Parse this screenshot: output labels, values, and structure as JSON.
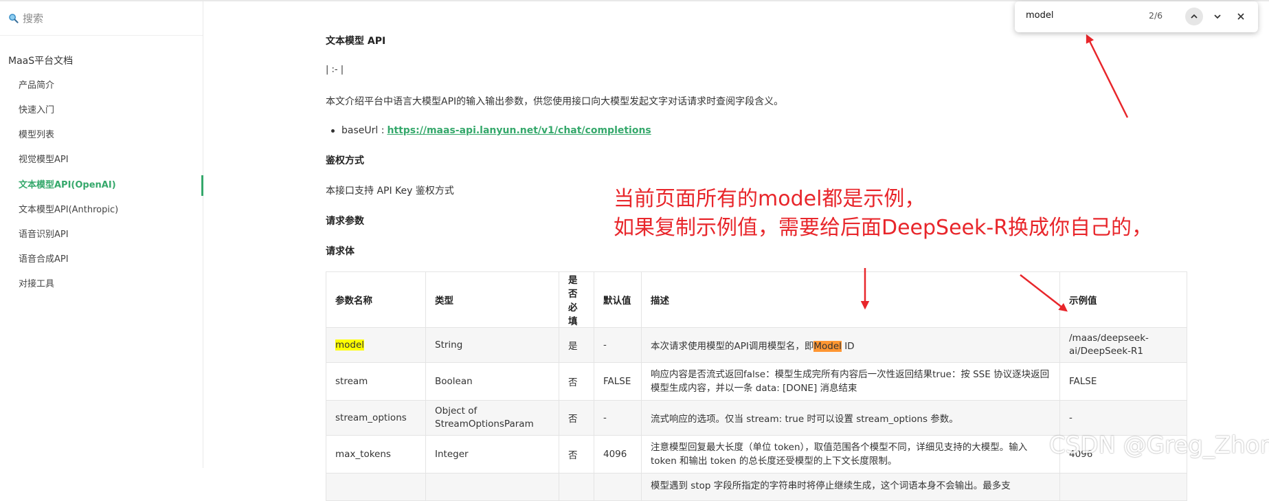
{
  "sidebar": {
    "search_placeholder": "搜索",
    "title": "MaaS平台文档",
    "items": [
      {
        "label": "产品简介"
      },
      {
        "label": "快速入门"
      },
      {
        "label": "模型列表"
      },
      {
        "label": "视觉模型API"
      },
      {
        "label": "文本模型API(OpenAI)",
        "active": true
      },
      {
        "label": "文本模型API(Anthropic)"
      },
      {
        "label": "语音识别API"
      },
      {
        "label": "语音合成API"
      },
      {
        "label": "对接工具"
      }
    ],
    "accent_color": "#35a86b"
  },
  "content": {
    "heading": "文本模型 API",
    "table_artifact": "| :- |",
    "intro": "本文介绍平台中语言大模型API的输入输出参数，供您使用接口向大模型发起文字对话请求时查阅字段含义。",
    "baseurl_label": "baseUrl :",
    "baseurl_link": "https://maas-api.lanyun.net/v1/chat/completions",
    "auth_heading": "鉴权方式",
    "auth_text": "本接口支持 API Key 鉴权方式",
    "params_heading": "请求参数",
    "body_heading": "请求体",
    "table": {
      "headers": [
        "参数名称",
        "类型",
        "是否必填",
        "默认值",
        "描述",
        "示例值"
      ],
      "rows": [
        {
          "name": "model",
          "type": "String",
          "required": "是",
          "default": "-",
          "desc_pre": "本次请求使用模型的API调用模型名，即",
          "desc_hl": "Model",
          "desc_post": " ID",
          "example": "/maas/deepseek-ai/DeepSeek-R1"
        },
        {
          "name": "stream",
          "type": "Boolean",
          "required": "否",
          "default": "FALSE",
          "desc": "响应内容是否流式返回false：模型生成完所有内容后一次性返回结果true：按 SSE 协议逐块返回模型生成内容，并以一条 data: [DONE] 消息结束",
          "example": "FALSE"
        },
        {
          "name": "stream_options",
          "type": "Object of StreamOptionsParam",
          "required": "否",
          "default": "-",
          "desc": "流式响应的选项。仅当 stream: true 时可以设置 stream_options 参数。",
          "example": "-"
        },
        {
          "name": "max_tokens",
          "type": "Integer",
          "required": "否",
          "default": "4096",
          "desc": "注意模型回复最大长度（单位 token），取值范围各个模型不同，详细见支持的大模型。输入 token 和输出 token 的总长度还受模型的上下文长度限制。",
          "example": "4096"
        },
        {
          "name": "",
          "type": "",
          "required": "",
          "default": "",
          "desc": "模型遇到 stop 字段所指定的字符串时将停止继续生成，这个词语本身不会输出。最多支",
          "example": ""
        }
      ]
    }
  },
  "annotation": {
    "line1": "当前页面所有的model都是示例，",
    "line2": "如果复制示例值，需要给后面DeepSeek-R换成你自己的，",
    "color": "#e8262b"
  },
  "findbar": {
    "query": "model",
    "count": "2/6"
  },
  "watermark": "CSDN @Greg_Zhong"
}
